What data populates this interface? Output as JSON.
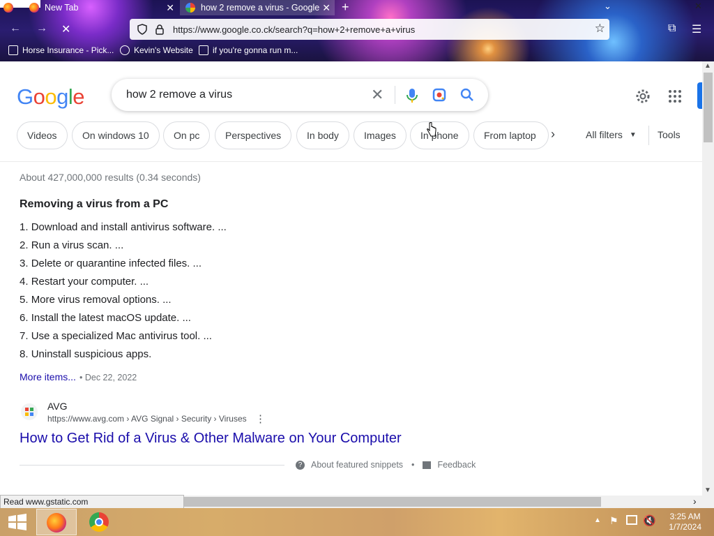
{
  "browser": {
    "tabs": [
      {
        "label": ""
      },
      {
        "label": "New Tab"
      },
      {
        "label": "how 2 remove a virus - Google"
      }
    ],
    "new_tab_label": "+",
    "url": "https://www.google.co.ck/search?q=how+2+remove+a+virus",
    "bookmarks": [
      {
        "label": "Horse Insurance - Pick..."
      },
      {
        "label": "Kevin's Website"
      },
      {
        "label": "if you're gonna run m..."
      }
    ]
  },
  "search": {
    "logo": "Google",
    "query": "how 2 remove a virus",
    "chips": [
      "Videos",
      "On windows 10",
      "On pc",
      "Perspectives",
      "In body",
      "Images",
      "In phone",
      "From laptop"
    ],
    "all_filters_label": "All filters",
    "tools_label": "Tools"
  },
  "results": {
    "stats": "About 427,000,000 results (0.34 seconds)",
    "snippet_heading": "Removing a virus from a PC",
    "snippet_items": [
      "Download and install antivirus software. ...",
      "Run a virus scan. ...",
      "Delete or quarantine infected files. ...",
      "Restart your computer. ...",
      "More virus removal options. ...",
      "Install the latest macOS update. ...",
      "Use a specialized Mac antivirus tool. ...",
      "Uninstall suspicious apps."
    ],
    "more_items_label": "More items...",
    "snippet_date": "Dec 22, 2022",
    "source_name": "AVG",
    "source_cite": "https://www.avg.com › AVG Signal › Security › Viruses",
    "result_title": "How to Get Rid of a Virus & Other Malware on Your Computer",
    "about_snippets": "About featured snippets",
    "feedback": "Feedback"
  },
  "status_bar": "Read www.gstatic.com",
  "taskbar": {
    "time": "3:25 AM",
    "date": "1/7/2024"
  },
  "colors": {
    "link": "#1a0dab",
    "google_blue": "#4285f4",
    "google_red": "#ea4335",
    "google_yellow": "#fbbc05",
    "google_green": "#34a853"
  }
}
